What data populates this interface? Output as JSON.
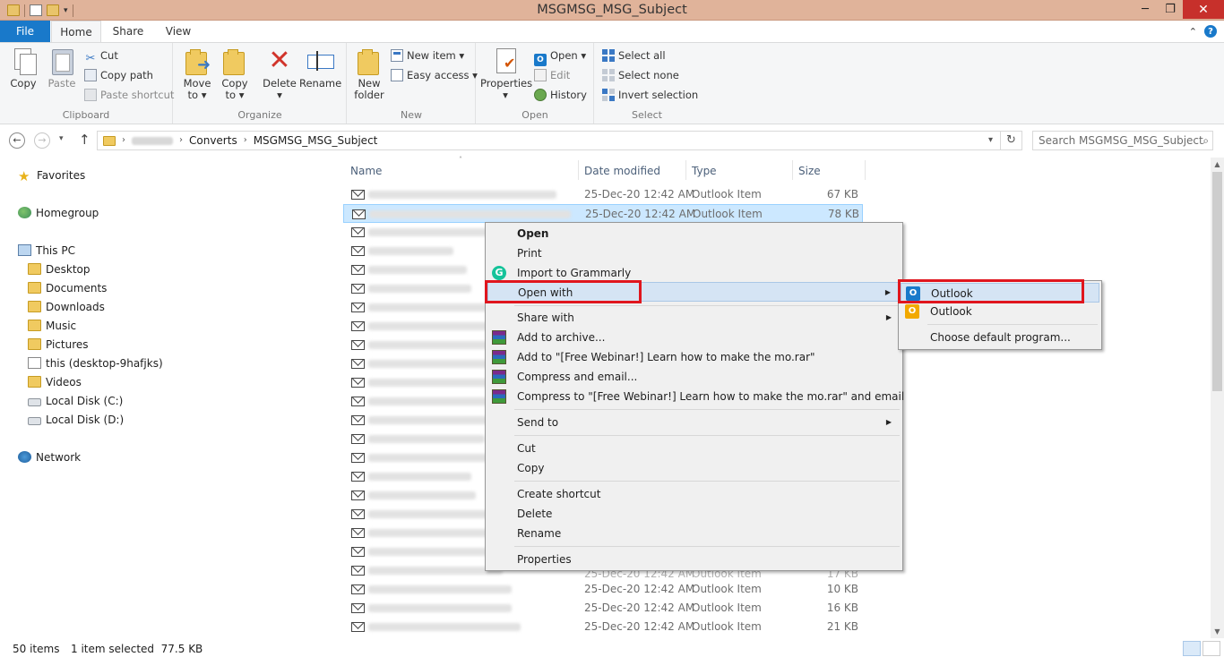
{
  "window": {
    "title": "MSGMSG_MSG_Subject",
    "minimize": "─",
    "restore": "❐",
    "close": "✕"
  },
  "tabs": {
    "file": "File",
    "home": "Home",
    "share": "Share",
    "view": "View"
  },
  "ribbon": {
    "clipboard": {
      "label": "Clipboard",
      "copy": "Copy",
      "paste": "Paste",
      "cut": "Cut",
      "copy_path": "Copy path",
      "paste_shortcut": "Paste shortcut"
    },
    "organize": {
      "label": "Organize",
      "move_to": "Move",
      "move_to_2": "to ▾",
      "copy_to": "Copy",
      "copy_to_2": "to ▾",
      "delete": "Delete",
      "delete_2": "▾",
      "rename": "Rename"
    },
    "new": {
      "label": "New",
      "new_folder": "New",
      "new_folder_2": "folder",
      "new_item": "New item ▾",
      "easy_access": "Easy access ▾"
    },
    "open": {
      "label": "Open",
      "properties": "Properties",
      "properties_2": "▾",
      "open": "Open ▾",
      "edit": "Edit",
      "history": "History"
    },
    "select": {
      "label": "Select",
      "select_all": "Select all",
      "select_none": "Select none",
      "invert_selection": "Invert selection"
    }
  },
  "address": {
    "crumb_1": "Converts",
    "crumb_2": "MSGMSG_MSG_Subject",
    "search_placeholder": "Search MSGMSG_MSG_Subject"
  },
  "navpane": {
    "favorites": "Favorites",
    "homegroup": "Homegroup",
    "this_pc": "This PC",
    "items": [
      "Desktop",
      "Documents",
      "Downloads",
      "Music",
      "Pictures",
      "this (desktop-9hafjks)",
      "Videos",
      "Local Disk (C:)",
      "Local Disk (D:)"
    ],
    "network": "Network"
  },
  "columns": {
    "name": "Name",
    "date": "Date modified",
    "type": "Type",
    "size": "Size"
  },
  "rows": [
    {
      "date": "25-Dec-20 12:42 AM",
      "type": "Outlook Item",
      "size": "67 KB"
    },
    {
      "date": "25-Dec-20 12:42 AM",
      "type": "Outlook Item",
      "size": "78 KB"
    },
    {
      "date": "25-Dec-20 12:42 AM",
      "type": "Outlook Item",
      "size": "10 KB"
    },
    {
      "date": "25-Dec-20 12:42 AM",
      "type": "Outlook Item",
      "size": "16 KB"
    },
    {
      "date": "25-Dec-20 12:42 AM",
      "type": "Outlook Item",
      "size": "21 KB"
    },
    {
      "partial_date": "25-Dec-20 12:42 AM",
      "partial_type": "Outlook Item",
      "partial_size": "17 KB"
    }
  ],
  "context_menu": {
    "open": "Open",
    "print": "Print",
    "import_grammarly": "Import to Grammarly",
    "open_with": "Open with",
    "share_with": "Share with",
    "add_archive": "Add to archive...",
    "add_rar": "Add to \"[Free Webinar!] Learn how to make the mo.rar\"",
    "compress_email": "Compress and email...",
    "compress_rar_email": "Compress to \"[Free Webinar!] Learn how to make the mo.rar\" and email",
    "send_to": "Send to",
    "cut": "Cut",
    "copy": "Copy",
    "create_shortcut": "Create shortcut",
    "delete": "Delete",
    "rename": "Rename",
    "properties": "Properties"
  },
  "submenu": {
    "outlook_1": "Outlook",
    "outlook_2": "Outlook",
    "choose_default": "Choose default program..."
  },
  "status": {
    "items": "50 items",
    "selected": "1 item selected  77.5 KB"
  },
  "colors": {
    "file_tab": "#1979ca",
    "titlebar": "#e0b39a",
    "close": "#c7302b",
    "annotation": "#e0161e",
    "selection": "#cce8ff"
  }
}
